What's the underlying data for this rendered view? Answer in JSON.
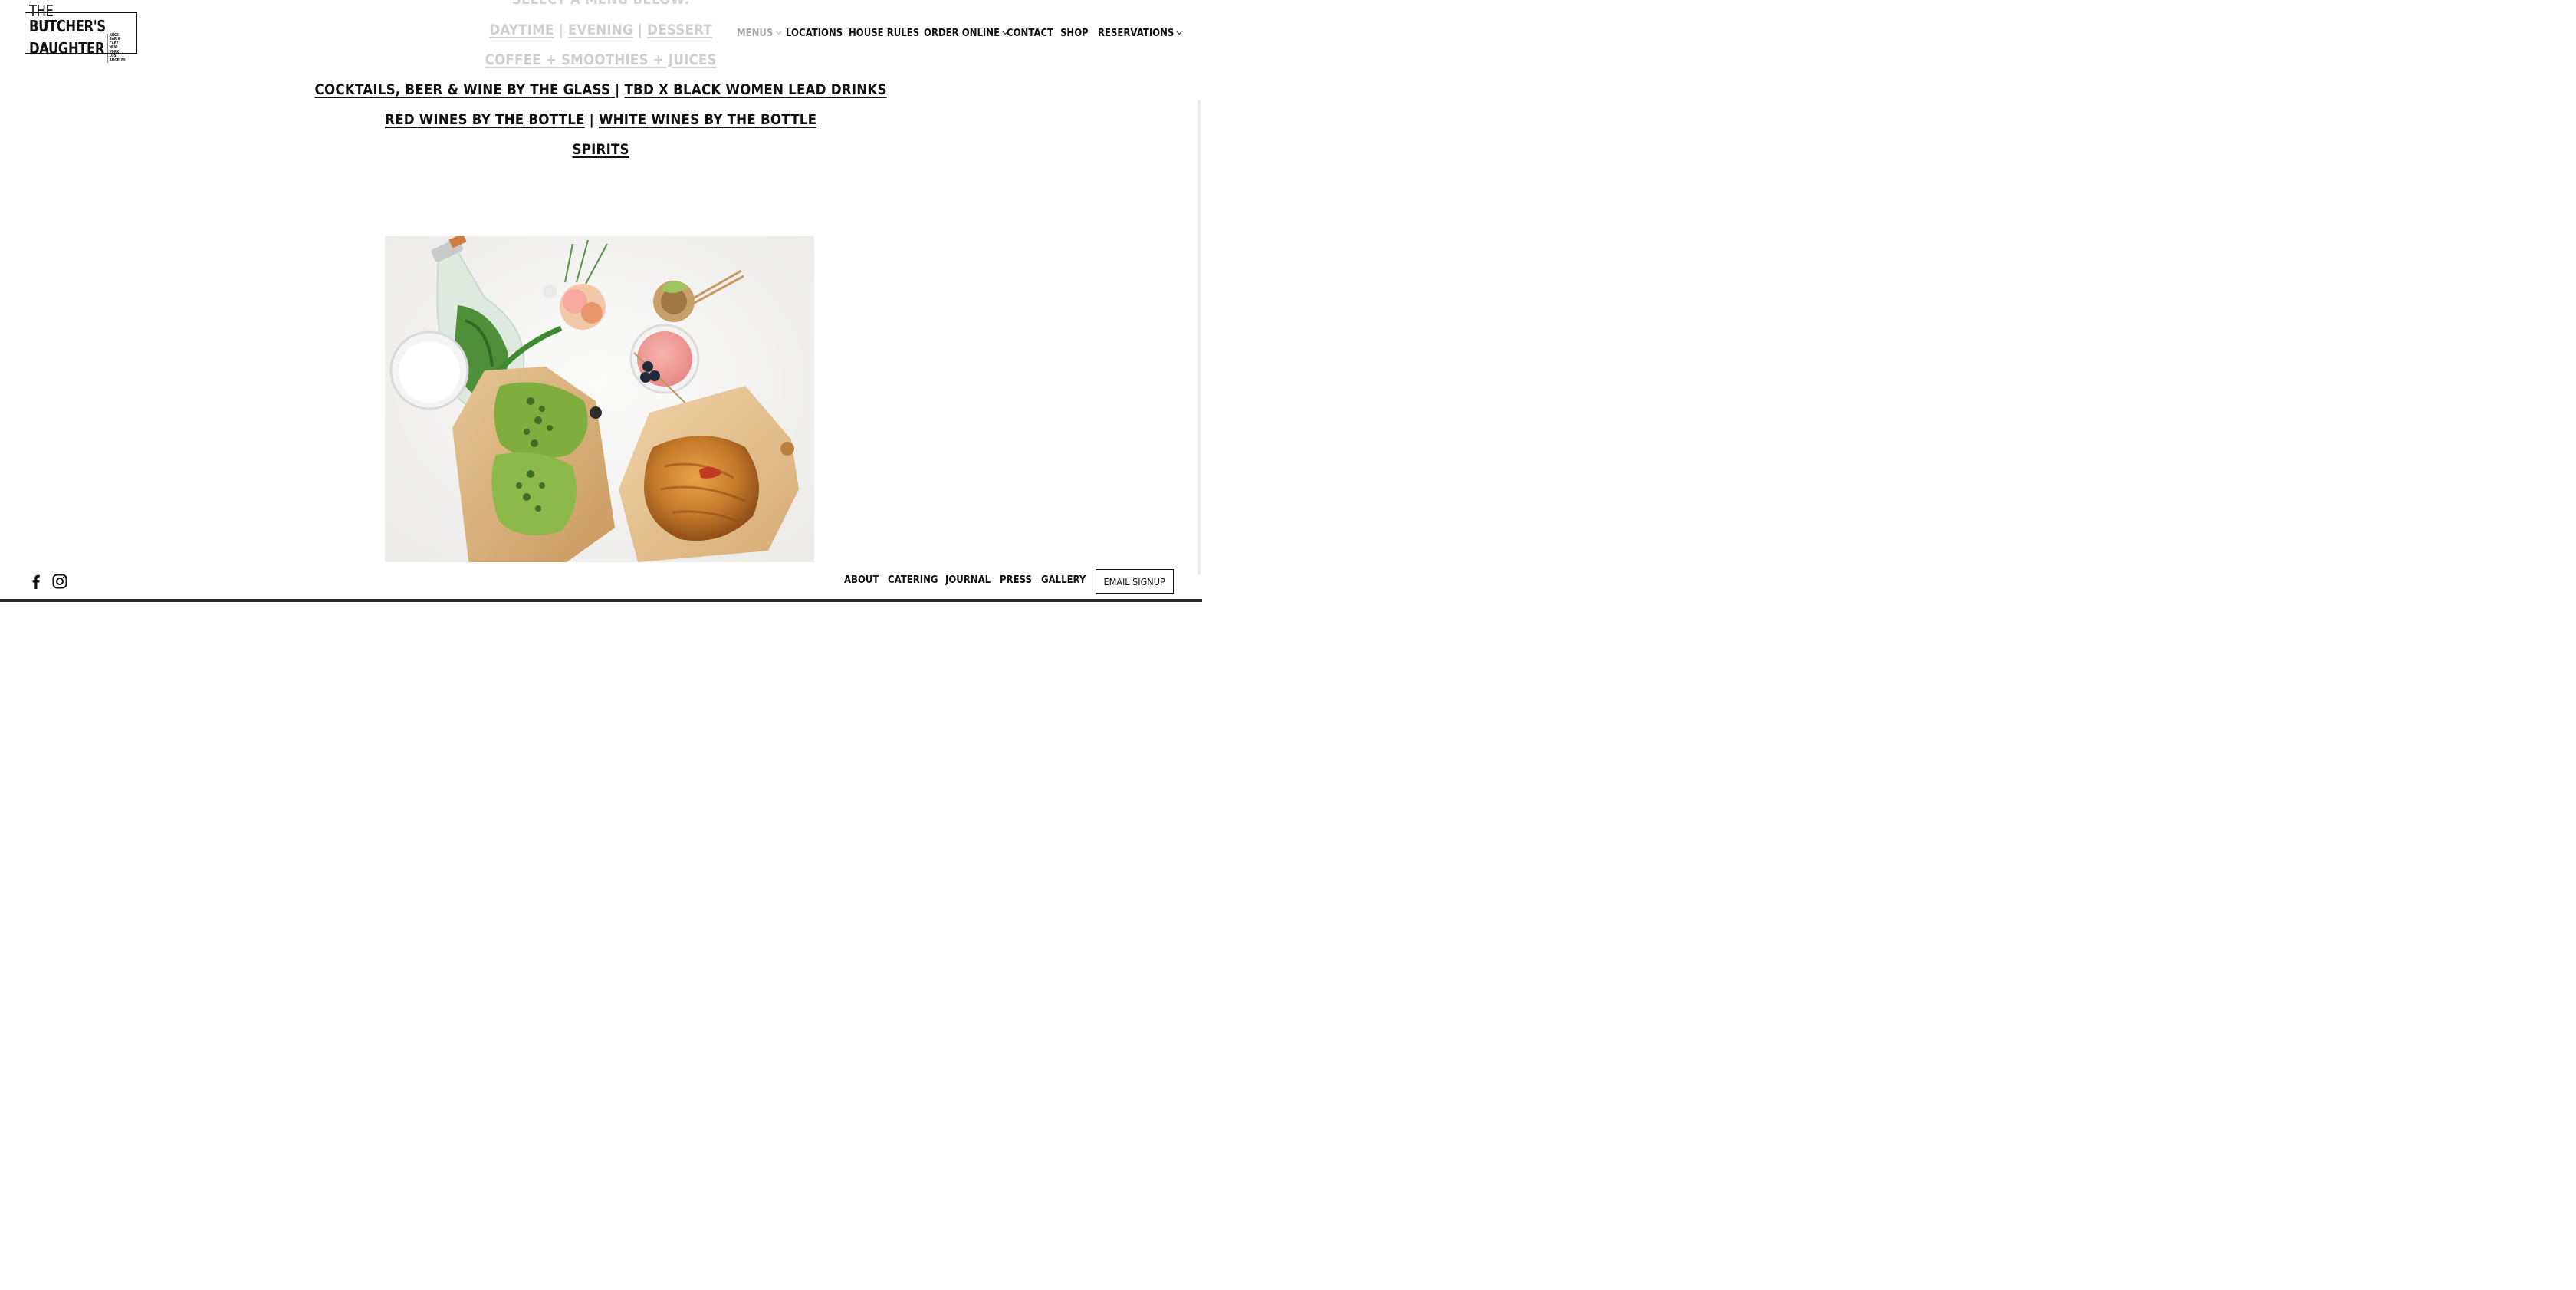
{
  "header": {
    "logo": {
      "line1_light": "THE",
      "line1_bold": "BUTCHER'S",
      "line2": "DAUGHTER",
      "tagline": [
        "JUICE BAR & CAFE",
        "NEW YORK",
        "LOS ANGELES"
      ]
    },
    "nav": [
      {
        "label": "MENUS",
        "dropdown": true,
        "active": true
      },
      {
        "label": "LOCATIONS",
        "dropdown": false
      },
      {
        "label": "HOUSE RULES",
        "dropdown": false
      },
      {
        "label": "ORDER ONLINE",
        "dropdown": true
      },
      {
        "label": "CONTACT",
        "dropdown": false
      },
      {
        "label": "SHOP",
        "dropdown": false
      },
      {
        "label": "RESERVATIONS",
        "dropdown": true
      }
    ]
  },
  "content": {
    "heading": "SELECT A MENU BELOW:",
    "rows": [
      {
        "links": [
          "DAYTIME",
          "EVENING",
          "DESSERT "
        ],
        "separator": "|"
      },
      {
        "links": [
          "COFFEE + SMOOTHIES + JUICES"
        ]
      },
      {
        "links": [
          "COCKTAILS, BEER & WINE BY THE GLASS ",
          "TBD X BLACK WOMEN LEAD DRINKS"
        ],
        "separator": "|"
      },
      {
        "links": [
          "RED WINES BY THE BOTTLE",
          "WHITE WINES BY THE BOTTLE"
        ],
        "separator": "|"
      },
      {
        "links": [
          "SPIRITS"
        ]
      }
    ]
  },
  "footer": {
    "social": [
      "facebook-icon",
      "instagram-icon"
    ],
    "links": [
      "ABOUT",
      "CATERING",
      "JOURNAL",
      "PRESS",
      "GALLERY"
    ],
    "email_button": "EMAIL SIGNUP"
  },
  "colors": {
    "text": "#111111",
    "muted": "#a8a8a8",
    "faded": "#cfcfcf",
    "background": "#ffffff"
  }
}
